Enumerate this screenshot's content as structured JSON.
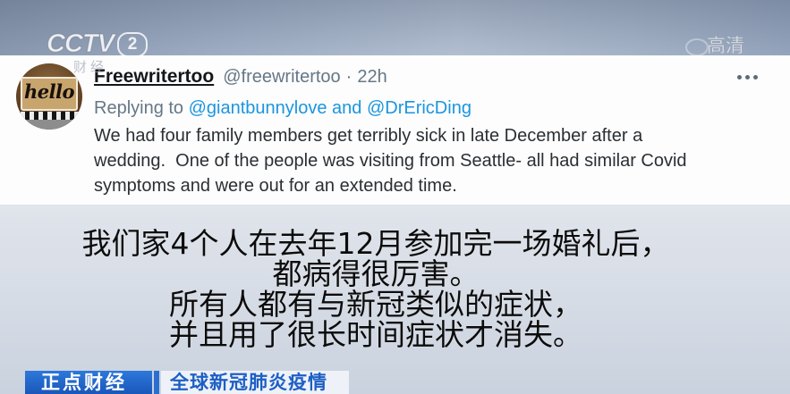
{
  "broadcast": {
    "channel_logo_text": "CCTV",
    "channel_number": "2",
    "channel_name": "财经",
    "hd_badge": "高清"
  },
  "tweet": {
    "avatar_text": "hello",
    "display_name": "Freewritertoo",
    "handle": "@freewritertoo",
    "separator": "·",
    "timestamp": "22h",
    "replying_to_prefix": "Replying to",
    "replying_to_targets": "@giantbunnylove and @DrEricDing",
    "body_lines": [
      "We had four family members get terribly sick in late December after a",
      "wedding.  One of the people was visiting from Seattle- all had similar Covid",
      "symptoms and were out for an extended time."
    ]
  },
  "subtitles": {
    "lines": [
      "我们家4个人在去年12月参加完一场婚礼后，",
      "都病得很厉害。",
      "所有人都有与新冠类似的症状，",
      "并且用了很长时间症状才消失。"
    ]
  },
  "lower_third": {
    "program": "正点财经",
    "headline": "全球新冠肺炎疫情"
  },
  "icons": {
    "more": "more-dots-icon"
  },
  "colors": {
    "link_blue": "#1b95e0",
    "text_primary": "#14171a",
    "text_secondary": "#657786",
    "banner_blue": "#1f63c4"
  }
}
